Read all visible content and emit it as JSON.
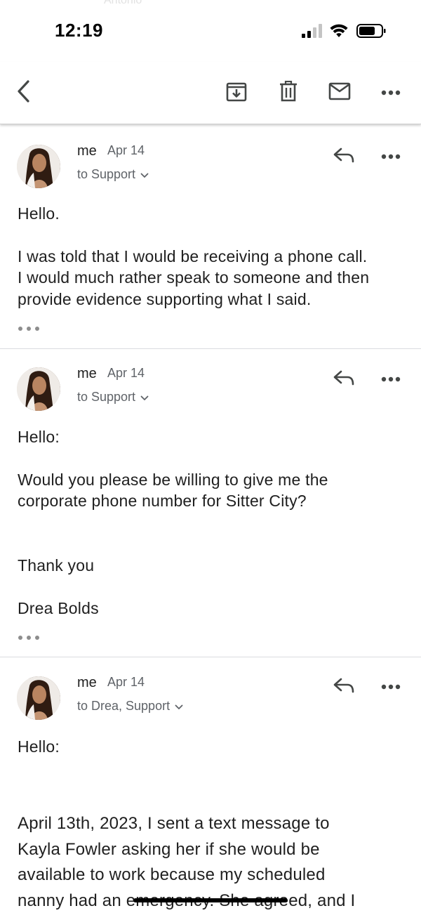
{
  "status_bar": {
    "time": "12:19",
    "ghost_text": "Antonio",
    "icons": [
      "cellular-signal-icon",
      "wifi-icon",
      "battery-icon"
    ]
  },
  "toolbar": {
    "icons": [
      "back-icon",
      "archive-icon",
      "delete-icon",
      "mark-unread-icon",
      "more-icon"
    ]
  },
  "messages": [
    {
      "sender": "me",
      "date": "Apr 14",
      "recipients": "to Support",
      "body": [
        "Hello.",
        "I was told that I would be receiving a phone call.",
        "I would much rather speak to someone and then",
        "provide evidence supporting what I said."
      ]
    },
    {
      "sender": "me",
      "date": "Apr 14",
      "recipients": "to Support",
      "body": [
        "Hello:",
        "Would you please be willing to give me the",
        "corporate phone number for Sitter City?",
        "Thank you",
        "Drea Bolds"
      ]
    },
    {
      "sender": "me",
      "date": "Apr 14",
      "recipients": "to Drea, Support",
      "body": [
        "Hello:",
        "April 13th, 2023, I sent a text message to",
        "Kayla Fowler asking her if she would be",
        "available to work because my scheduled",
        "nanny had an emergency. She agreed, and I"
      ]
    }
  ],
  "colors": {
    "text_primary": "#1f1f1f",
    "text_secondary": "#5f6368",
    "divider": "#dadce0",
    "icon": "#444746"
  }
}
